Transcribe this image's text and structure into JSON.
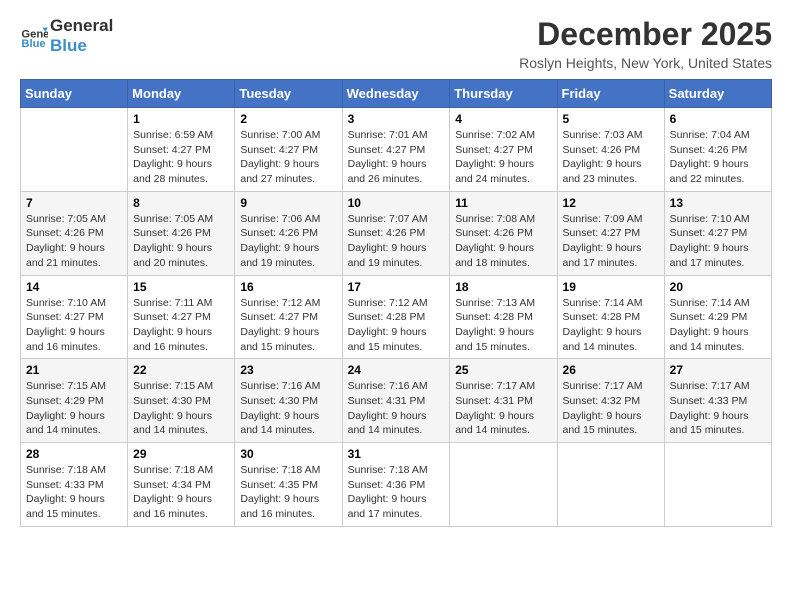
{
  "logo": {
    "line1": "General",
    "line2": "Blue"
  },
  "title": "December 2025",
  "location": "Roslyn Heights, New York, United States",
  "weekdays": [
    "Sunday",
    "Monday",
    "Tuesday",
    "Wednesday",
    "Thursday",
    "Friday",
    "Saturday"
  ],
  "weeks": [
    [
      {
        "day": "",
        "sunrise": "",
        "sunset": "",
        "daylight": ""
      },
      {
        "day": "1",
        "sunrise": "Sunrise: 6:59 AM",
        "sunset": "Sunset: 4:27 PM",
        "daylight": "Daylight: 9 hours and 28 minutes."
      },
      {
        "day": "2",
        "sunrise": "Sunrise: 7:00 AM",
        "sunset": "Sunset: 4:27 PM",
        "daylight": "Daylight: 9 hours and 27 minutes."
      },
      {
        "day": "3",
        "sunrise": "Sunrise: 7:01 AM",
        "sunset": "Sunset: 4:27 PM",
        "daylight": "Daylight: 9 hours and 26 minutes."
      },
      {
        "day": "4",
        "sunrise": "Sunrise: 7:02 AM",
        "sunset": "Sunset: 4:27 PM",
        "daylight": "Daylight: 9 hours and 24 minutes."
      },
      {
        "day": "5",
        "sunrise": "Sunrise: 7:03 AM",
        "sunset": "Sunset: 4:26 PM",
        "daylight": "Daylight: 9 hours and 23 minutes."
      },
      {
        "day": "6",
        "sunrise": "Sunrise: 7:04 AM",
        "sunset": "Sunset: 4:26 PM",
        "daylight": "Daylight: 9 hours and 22 minutes."
      }
    ],
    [
      {
        "day": "7",
        "sunrise": "Sunrise: 7:05 AM",
        "sunset": "Sunset: 4:26 PM",
        "daylight": "Daylight: 9 hours and 21 minutes."
      },
      {
        "day": "8",
        "sunrise": "Sunrise: 7:05 AM",
        "sunset": "Sunset: 4:26 PM",
        "daylight": "Daylight: 9 hours and 20 minutes."
      },
      {
        "day": "9",
        "sunrise": "Sunrise: 7:06 AM",
        "sunset": "Sunset: 4:26 PM",
        "daylight": "Daylight: 9 hours and 19 minutes."
      },
      {
        "day": "10",
        "sunrise": "Sunrise: 7:07 AM",
        "sunset": "Sunset: 4:26 PM",
        "daylight": "Daylight: 9 hours and 19 minutes."
      },
      {
        "day": "11",
        "sunrise": "Sunrise: 7:08 AM",
        "sunset": "Sunset: 4:26 PM",
        "daylight": "Daylight: 9 hours and 18 minutes."
      },
      {
        "day": "12",
        "sunrise": "Sunrise: 7:09 AM",
        "sunset": "Sunset: 4:27 PM",
        "daylight": "Daylight: 9 hours and 17 minutes."
      },
      {
        "day": "13",
        "sunrise": "Sunrise: 7:10 AM",
        "sunset": "Sunset: 4:27 PM",
        "daylight": "Daylight: 9 hours and 17 minutes."
      }
    ],
    [
      {
        "day": "14",
        "sunrise": "Sunrise: 7:10 AM",
        "sunset": "Sunset: 4:27 PM",
        "daylight": "Daylight: 9 hours and 16 minutes."
      },
      {
        "day": "15",
        "sunrise": "Sunrise: 7:11 AM",
        "sunset": "Sunset: 4:27 PM",
        "daylight": "Daylight: 9 hours and 16 minutes."
      },
      {
        "day": "16",
        "sunrise": "Sunrise: 7:12 AM",
        "sunset": "Sunset: 4:27 PM",
        "daylight": "Daylight: 9 hours and 15 minutes."
      },
      {
        "day": "17",
        "sunrise": "Sunrise: 7:12 AM",
        "sunset": "Sunset: 4:28 PM",
        "daylight": "Daylight: 9 hours and 15 minutes."
      },
      {
        "day": "18",
        "sunrise": "Sunrise: 7:13 AM",
        "sunset": "Sunset: 4:28 PM",
        "daylight": "Daylight: 9 hours and 15 minutes."
      },
      {
        "day": "19",
        "sunrise": "Sunrise: 7:14 AM",
        "sunset": "Sunset: 4:28 PM",
        "daylight": "Daylight: 9 hours and 14 minutes."
      },
      {
        "day": "20",
        "sunrise": "Sunrise: 7:14 AM",
        "sunset": "Sunset: 4:29 PM",
        "daylight": "Daylight: 9 hours and 14 minutes."
      }
    ],
    [
      {
        "day": "21",
        "sunrise": "Sunrise: 7:15 AM",
        "sunset": "Sunset: 4:29 PM",
        "daylight": "Daylight: 9 hours and 14 minutes."
      },
      {
        "day": "22",
        "sunrise": "Sunrise: 7:15 AM",
        "sunset": "Sunset: 4:30 PM",
        "daylight": "Daylight: 9 hours and 14 minutes."
      },
      {
        "day": "23",
        "sunrise": "Sunrise: 7:16 AM",
        "sunset": "Sunset: 4:30 PM",
        "daylight": "Daylight: 9 hours and 14 minutes."
      },
      {
        "day": "24",
        "sunrise": "Sunrise: 7:16 AM",
        "sunset": "Sunset: 4:31 PM",
        "daylight": "Daylight: 9 hours and 14 minutes."
      },
      {
        "day": "25",
        "sunrise": "Sunrise: 7:17 AM",
        "sunset": "Sunset: 4:31 PM",
        "daylight": "Daylight: 9 hours and 14 minutes."
      },
      {
        "day": "26",
        "sunrise": "Sunrise: 7:17 AM",
        "sunset": "Sunset: 4:32 PM",
        "daylight": "Daylight: 9 hours and 15 minutes."
      },
      {
        "day": "27",
        "sunrise": "Sunrise: 7:17 AM",
        "sunset": "Sunset: 4:33 PM",
        "daylight": "Daylight: 9 hours and 15 minutes."
      }
    ],
    [
      {
        "day": "28",
        "sunrise": "Sunrise: 7:18 AM",
        "sunset": "Sunset: 4:33 PM",
        "daylight": "Daylight: 9 hours and 15 minutes."
      },
      {
        "day": "29",
        "sunrise": "Sunrise: 7:18 AM",
        "sunset": "Sunset: 4:34 PM",
        "daylight": "Daylight: 9 hours and 16 minutes."
      },
      {
        "day": "30",
        "sunrise": "Sunrise: 7:18 AM",
        "sunset": "Sunset: 4:35 PM",
        "daylight": "Daylight: 9 hours and 16 minutes."
      },
      {
        "day": "31",
        "sunrise": "Sunrise: 7:18 AM",
        "sunset": "Sunset: 4:36 PM",
        "daylight": "Daylight: 9 hours and 17 minutes."
      },
      {
        "day": "",
        "sunrise": "",
        "sunset": "",
        "daylight": ""
      },
      {
        "day": "",
        "sunrise": "",
        "sunset": "",
        "daylight": ""
      },
      {
        "day": "",
        "sunrise": "",
        "sunset": "",
        "daylight": ""
      }
    ]
  ]
}
